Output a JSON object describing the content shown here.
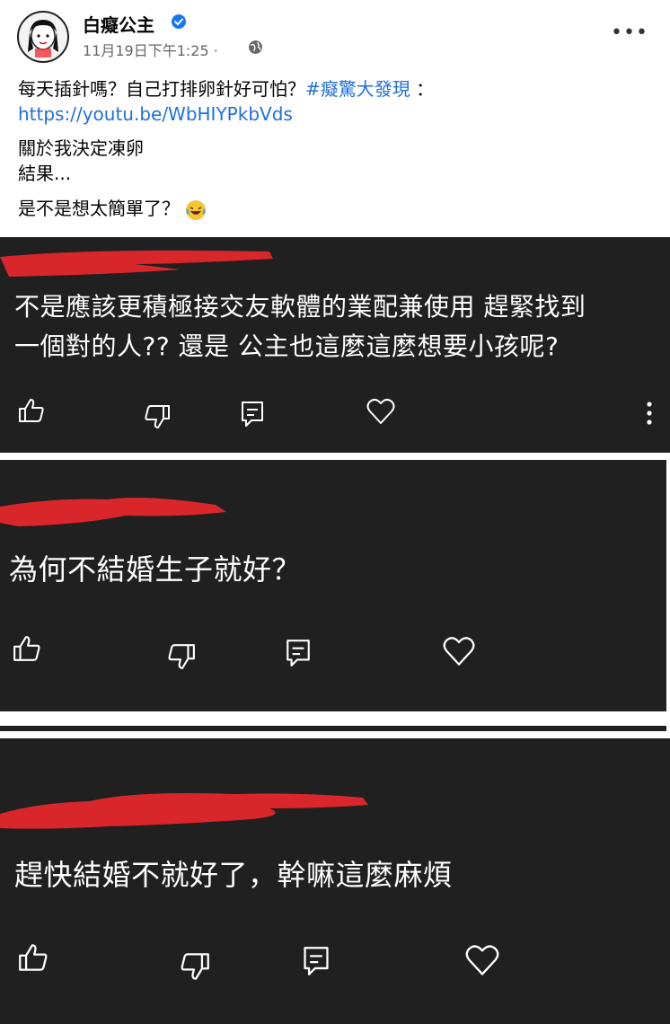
{
  "post": {
    "author": "白癡公主",
    "timestamp": "11月19日下午1:25 ·",
    "line1_text": "每天插針嗎？自己打排卵針好可怕？",
    "hashtag": "#癡驚大發現",
    "line1_tail": " ：",
    "link": "https://youtu.be/WbHIYPkbVds",
    "line2": "關於我決定凍卵",
    "line3": "結果...",
    "line4": "是不是想太簡單了？"
  },
  "comments": [
    {
      "text_line1": "不是應該更積極接交友軟體的業配兼使用 趕緊找到",
      "text_line2": "一個對的人?? 還是 公主也這麼這麼想要小孩呢?",
      "author_redacted": true
    },
    {
      "text_line1": "為何不結婚生子就好？",
      "author_redacted": true
    },
    {
      "text_line1": "趕快結婚不就好了，幹嘛這麼麻煩",
      "author_redacted": true
    }
  ],
  "icons": [
    "verified-badge-icon",
    "globe-icon",
    "more-options-icon",
    "laughing-emoji-icon",
    "thumbs-up-icon",
    "thumbs-down-icon",
    "reply-icon",
    "heart-icon",
    "vertical-more-icon"
  ],
  "colors": {
    "panel": "#202020",
    "redaction": "#d9262a",
    "link": "#216fdb"
  }
}
